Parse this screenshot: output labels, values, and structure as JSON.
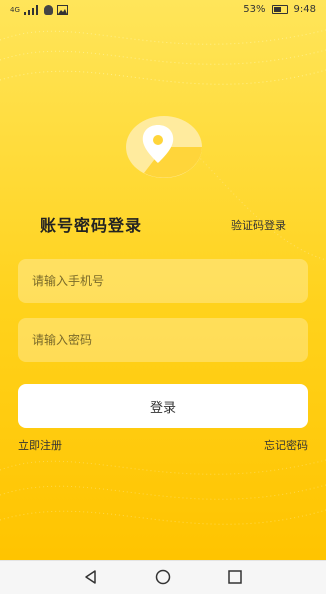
{
  "status_bar": {
    "network": "4G",
    "battery": "53%",
    "time": "9:48",
    "icons": [
      "signal-icon",
      "wechat-icon",
      "image-icon",
      "battery-icon"
    ]
  },
  "logo": {
    "icon": "location-pin-icon",
    "colors": {
      "pin": "#ffffff",
      "circle": "#ffeb9e",
      "shadow": "#ffd53a"
    }
  },
  "login": {
    "title": "账号密码登录",
    "alt_login": "验证码登录",
    "phone_placeholder": "请输入手机号",
    "password_placeholder": "请输入密码",
    "submit_label": "登录",
    "register_link": "立即注册",
    "forgot_link": "忘记密码"
  },
  "nav_bar": {
    "icons": [
      "back-icon",
      "home-icon",
      "recent-apps-icon"
    ]
  },
  "colors": {
    "background_top": "#ffe55a",
    "background_bottom": "#ffc400",
    "button": "#ffffff"
  }
}
